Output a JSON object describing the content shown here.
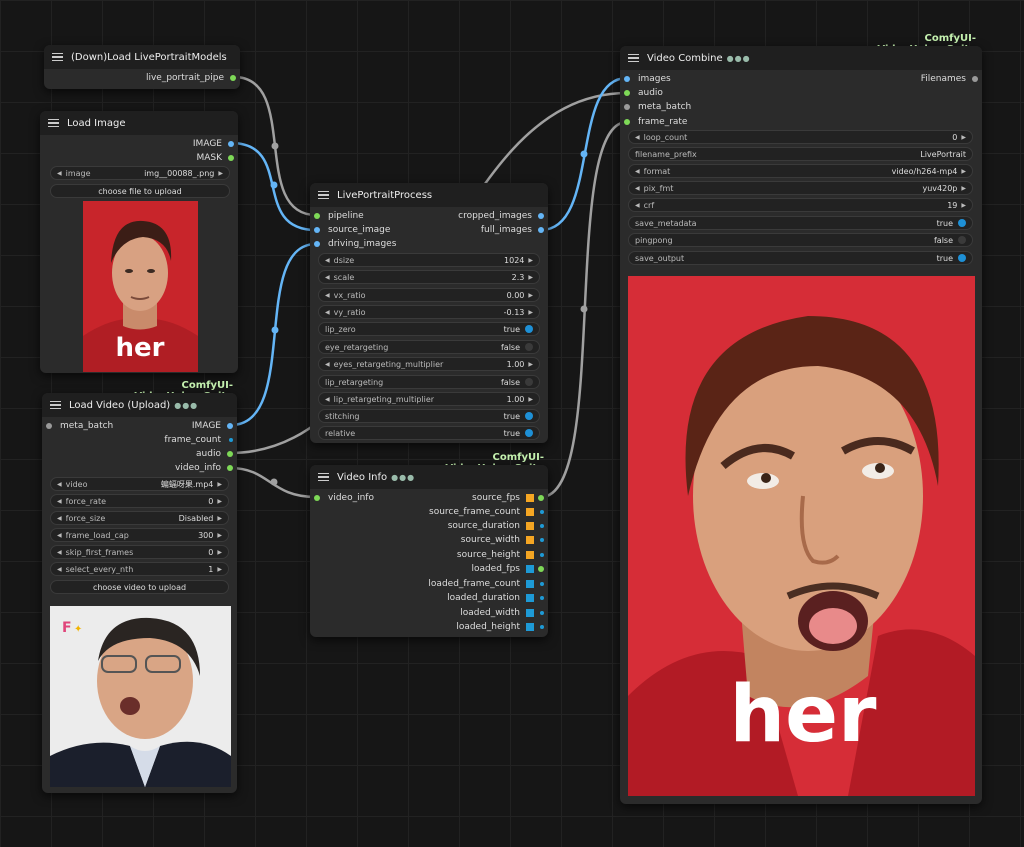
{
  "colors": {
    "canvas": "#161616",
    "node_body": "#2b2b2b",
    "node_header": "#1f1f1f",
    "pack_label": "#c5f2b0",
    "slot_image": "#64b5f6",
    "slot_other": "#7ed957",
    "slot_neutral": "#9a9a9a",
    "toggle_on": "#1e90d6",
    "square_orange": "#f5a623",
    "square_blue": "#1e9ad6"
  },
  "load_models": {
    "title": "(Down)Load LivePortraitModels",
    "output": "live_portrait_pipe"
  },
  "load_image": {
    "title": "Load Image",
    "outputs": [
      "IMAGE",
      "MASK"
    ],
    "image_label": "image",
    "image_value": "img__00088_.png",
    "upload_button": "choose file to upload",
    "caption": "her"
  },
  "load_video": {
    "pack": "ComfyUI-VideoHelperSuite",
    "title": "Load Video (Upload)",
    "badge": "●●●",
    "inputs": [
      "meta_batch"
    ],
    "outputs": [
      "IMAGE",
      "frame_count",
      "audio",
      "video_info"
    ],
    "widgets": [
      {
        "label": "video",
        "value": "蝙蝠呀果.mp4"
      },
      {
        "label": "force_rate",
        "value": "0"
      },
      {
        "label": "force_size",
        "value": "Disabled"
      },
      {
        "label": "frame_load_cap",
        "value": "300"
      },
      {
        "label": "skip_first_frames",
        "value": "0"
      },
      {
        "label": "select_every_nth",
        "value": "1"
      }
    ],
    "upload_button": "choose video to upload"
  },
  "process": {
    "title": "LivePortraitProcess",
    "inputs": [
      "pipeline",
      "source_image",
      "driving_images"
    ],
    "outputs": [
      "cropped_images",
      "full_images"
    ],
    "widgets": [
      {
        "label": "dsize",
        "value": "1024",
        "kind": "number"
      },
      {
        "label": "scale",
        "value": "2.3",
        "kind": "number"
      },
      {
        "label": "vx_ratio",
        "value": "0.00",
        "kind": "number"
      },
      {
        "label": "vy_ratio",
        "value": "-0.13",
        "kind": "number"
      },
      {
        "label": "lip_zero",
        "value": "true",
        "kind": "toggle"
      },
      {
        "label": "eye_retargeting",
        "value": "false",
        "kind": "toggle"
      },
      {
        "label": "eyes_retargeting_multiplier",
        "value": "1.00",
        "kind": "number"
      },
      {
        "label": "lip_retargeting",
        "value": "false",
        "kind": "toggle"
      },
      {
        "label": "lip_retargeting_multiplier",
        "value": "1.00",
        "kind": "number"
      },
      {
        "label": "stitching",
        "value": "true",
        "kind": "toggle"
      },
      {
        "label": "relative",
        "value": "true",
        "kind": "toggle"
      }
    ]
  },
  "video_info": {
    "pack": "ComfyUI-VideoHelperSuite",
    "title": "Video Info",
    "badge": "●●●",
    "inputs": [
      "video_info"
    ],
    "outputs": [
      {
        "label": "source_fps",
        "color": "orange"
      },
      {
        "label": "source_frame_count",
        "color": "orange"
      },
      {
        "label": "source_duration",
        "color": "orange"
      },
      {
        "label": "source_width",
        "color": "orange"
      },
      {
        "label": "source_height",
        "color": "orange"
      },
      {
        "label": "loaded_fps",
        "color": "blue"
      },
      {
        "label": "loaded_frame_count",
        "color": "blue"
      },
      {
        "label": "loaded_duration",
        "color": "blue"
      },
      {
        "label": "loaded_width",
        "color": "blue"
      },
      {
        "label": "loaded_height",
        "color": "blue"
      }
    ]
  },
  "combine": {
    "pack": "ComfyUI-VideoHelperSuite",
    "title": "Video Combine",
    "badge": "●●●",
    "inputs": [
      "images",
      "audio",
      "meta_batch",
      "frame_rate"
    ],
    "output": "Filenames",
    "widgets": [
      {
        "label": "loop_count",
        "value": "0",
        "kind": "number"
      },
      {
        "label": "filename_prefix",
        "value": "LivePortrait",
        "kind": "text"
      },
      {
        "label": "format",
        "value": "video/h264-mp4",
        "kind": "number"
      },
      {
        "label": "pix_fmt",
        "value": "yuv420p",
        "kind": "number"
      },
      {
        "label": "crf",
        "value": "19",
        "kind": "number"
      },
      {
        "label": "save_metadata",
        "value": "true",
        "kind": "toggle"
      },
      {
        "label": "pingpong",
        "value": "false",
        "kind": "toggle"
      },
      {
        "label": "save_output",
        "value": "true",
        "kind": "toggle"
      }
    ],
    "caption": "her"
  }
}
